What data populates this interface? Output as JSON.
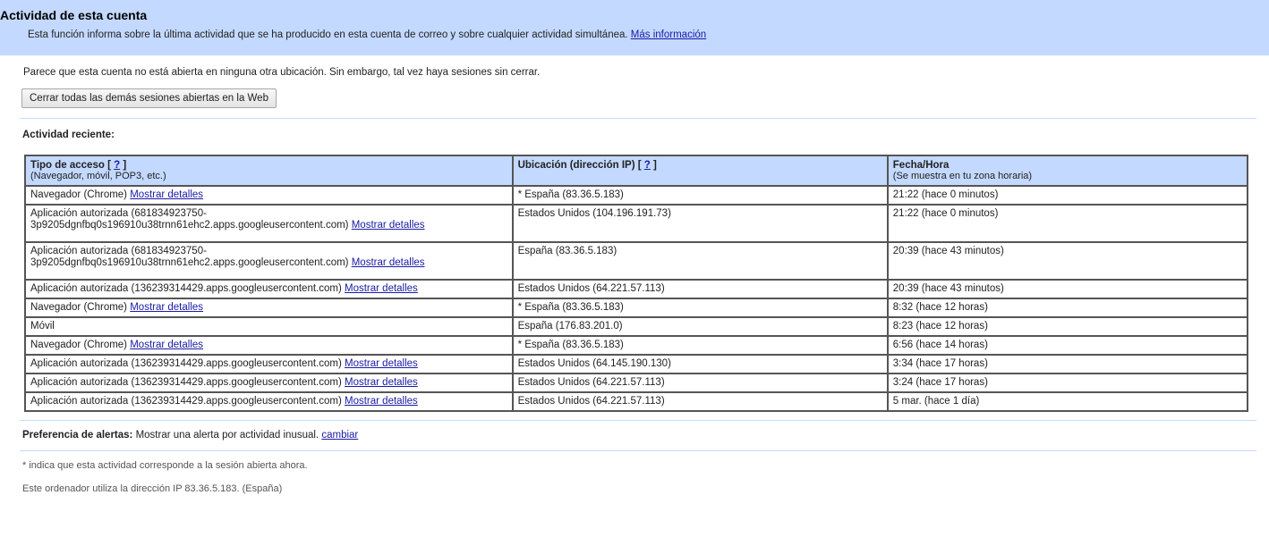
{
  "header": {
    "title": "Actividad de esta cuenta",
    "description": "Esta función informa sobre la última actividad que se ha producido en esta cuenta de correo y sobre cualquier actividad simultánea.",
    "more_info_link": "Más información"
  },
  "notice": "Parece que esta cuenta no está abierta en ninguna otra ubicación. Sin embargo, tal vez haya sesiones sin cerrar.",
  "close_sessions_button": "Cerrar todas las demás sesiones abiertas en la Web",
  "recent_activity_title": "Actividad reciente:",
  "table": {
    "headers": {
      "access_type": "Tipo de acceso",
      "access_type_help": "?",
      "access_type_sub": "(Navegador, móvil, POP3, etc.)",
      "location": "Ubicación (dirección IP)",
      "location_help": "?",
      "datetime": "Fecha/Hora",
      "datetime_sub": "(Se muestra en tu zona horaria)"
    },
    "rows": [
      {
        "access": "Navegador (Chrome)",
        "details": "Mostrar detalles",
        "location": "* España (83.36.5.183)",
        "time": "21:22 (hace 0 minutos)"
      },
      {
        "access": "Aplicación autorizada (681834923750-3p9205dgnfbq0s196910u38trnn61ehc2.apps.googleusercontent.com)",
        "details": "Mostrar detalles",
        "location": "Estados Unidos (104.196.191.73)",
        "time": "21:22 (hace 0 minutos)"
      },
      {
        "access": "Aplicación autorizada (681834923750-3p9205dgnfbq0s196910u38trnn61ehc2.apps.googleusercontent.com)",
        "details": "Mostrar detalles",
        "location": "España (83.36.5.183)",
        "time": "20:39 (hace 43 minutos)"
      },
      {
        "access": "Aplicación autorizada (136239314429.apps.googleusercontent.com)",
        "details": "Mostrar detalles",
        "location": "Estados Unidos (64.221.57.113)",
        "time": "20:39 (hace 43 minutos)"
      },
      {
        "access": "Navegador (Chrome)",
        "details": "Mostrar detalles",
        "location": "* España (83.36.5.183)",
        "time": "8:32 (hace 12 horas)"
      },
      {
        "access": "Móvil",
        "details": "",
        "location": "España (176.83.201.0)",
        "time": "8:23 (hace 12 horas)"
      },
      {
        "access": "Navegador (Chrome)",
        "details": "Mostrar detalles",
        "location": "* España (83.36.5.183)",
        "time": "6:56 (hace 14 horas)"
      },
      {
        "access": "Aplicación autorizada (136239314429.apps.googleusercontent.com)",
        "details": "Mostrar detalles",
        "location": "Estados Unidos (64.145.190.130)",
        "time": "3:34 (hace 17 horas)"
      },
      {
        "access": "Aplicación autorizada (136239314429.apps.googleusercontent.com)",
        "details": "Mostrar detalles",
        "location": "Estados Unidos (64.221.57.113)",
        "time": "3:24 (hace 17 horas)"
      },
      {
        "access": "Aplicación autorizada (136239314429.apps.googleusercontent.com)",
        "details": "Mostrar detalles",
        "location": "Estados Unidos (64.221.57.113)",
        "time": "5 mar. (hace 1 día)"
      }
    ]
  },
  "alerts": {
    "label": "Preferencia de alertas:",
    "value": "Mostrar una alerta por actividad inusual.",
    "change_link": "cambiar"
  },
  "footnotes": {
    "asterisk_note": "* indica que esta actividad corresponde a la sesión abierta ahora.",
    "ip_note": "Este ordenador utiliza la dirección IP 83.36.5.183. (España)"
  },
  "colors": {
    "header_bg": "#c3d9ff",
    "link": "#1a1aa6",
    "table_border": "#555555"
  }
}
